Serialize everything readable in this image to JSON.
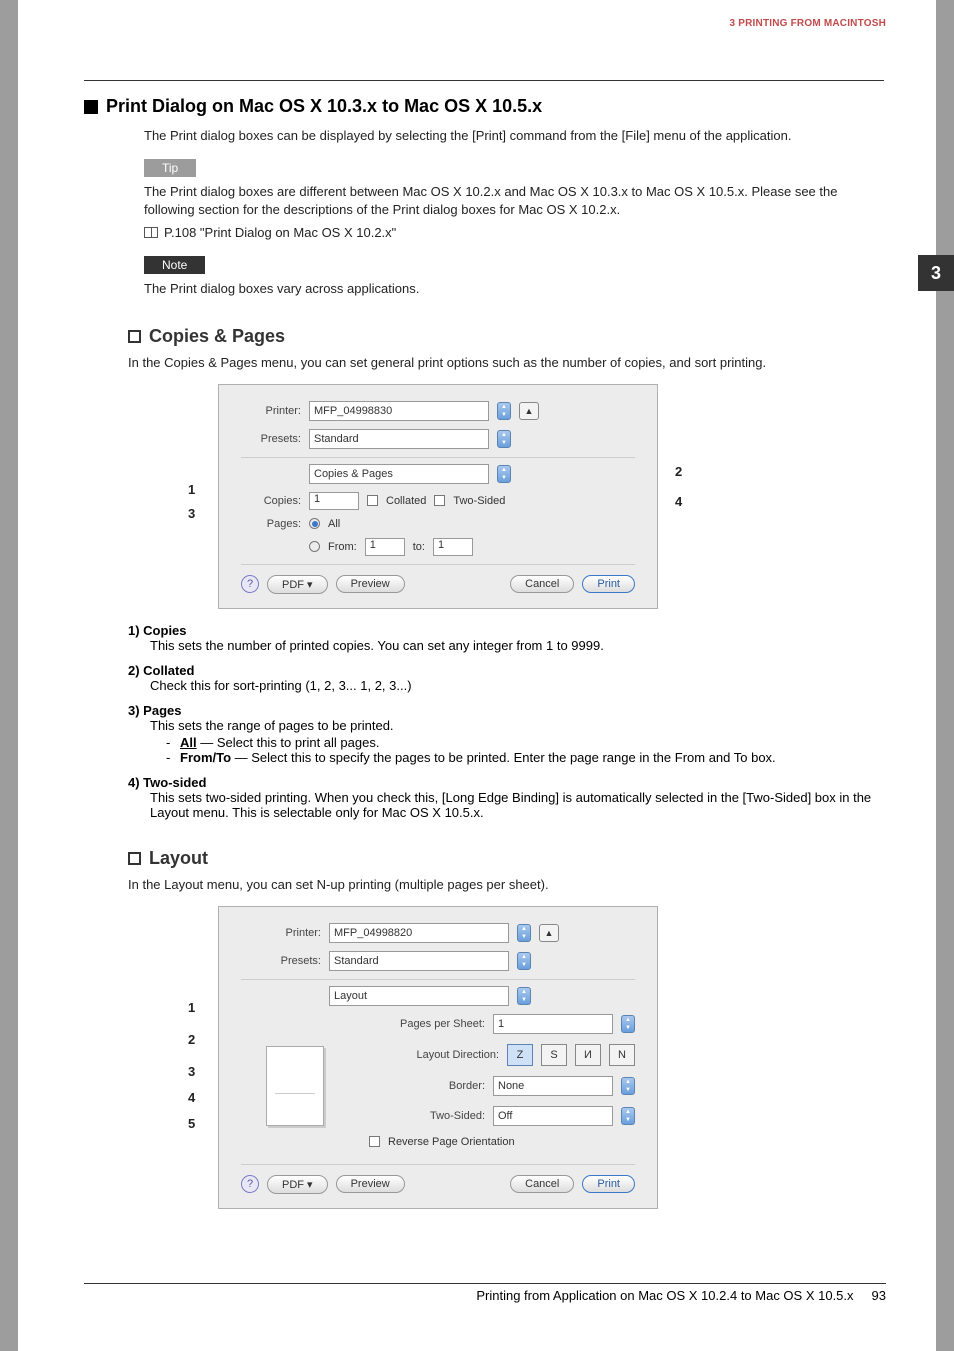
{
  "header": {
    "section": "3 PRINTING FROM MACINTOSH",
    "tab_number": "3"
  },
  "h1": {
    "title": "Print Dialog on Mac OS X 10.3.x to Mac OS X 10.5.x"
  },
  "intro": "The Print dialog boxes can be displayed by selecting the [Print] command from the [File] menu of the application.",
  "tip": {
    "label": "Tip",
    "text": "The Print dialog boxes are different between Mac OS X 10.2.x and Mac OS X 10.3.x to Mac OS X 10.5.x.  Please see the following section for the descriptions of the Print dialog boxes for Mac OS X 10.2.x.",
    "ref": "P.108 \"Print Dialog on Mac OS X 10.2.x\""
  },
  "note": {
    "label": "Note",
    "text": "The Print dialog boxes vary across applications."
  },
  "copies_pages": {
    "heading": "Copies & Pages",
    "intro": "In the Copies & Pages menu, you can set general print options such as the number of copies, and sort printing.",
    "dlg": {
      "printer_lbl": "Printer:",
      "printer_val": "MFP_04998830",
      "presets_lbl": "Presets:",
      "presets_val": "Standard",
      "pane_val": "Copies & Pages",
      "copies_lbl": "Copies:",
      "copies_val": "1",
      "collated_lbl": "Collated",
      "twosided_lbl": "Two-Sided",
      "pages_lbl": "Pages:",
      "all_lbl": "All",
      "from_lbl": "From:",
      "from_val": "1",
      "to_lbl": "to:",
      "to_val": "1",
      "pdf": "PDF ▾",
      "preview": "Preview",
      "cancel": "Cancel",
      "print": "Print",
      "help": "?",
      "c1": "1",
      "c2": "2",
      "c3": "3",
      "c4": "4"
    },
    "list": {
      "i1_t": "1)  Copies",
      "i1_d": "This sets the number of printed copies. You can set any integer from 1 to 9999.",
      "i2_t": "2)  Collated",
      "i2_d": "Check this for sort-printing (1, 2, 3... 1, 2, 3...)",
      "i3_t": "3)  Pages",
      "i3_d": "This sets the range of pages to be printed.",
      "i3_all_b": "All",
      "i3_all_r": " — Select this to print all pages.",
      "i3_ft_b": "From/To",
      "i3_ft_r": " — Select this to specify the pages to be printed. Enter the page range in the From and To box.",
      "i4_t": "4)  Two-sided",
      "i4_d": "This sets two-sided printing. When you check this, [Long Edge Binding] is automatically selected in the [Two-Sided] box in the Layout menu.  This is selectable only for Mac OS X 10.5.x."
    }
  },
  "layout": {
    "heading": "Layout",
    "intro": "In the Layout menu, you can set N-up printing (multiple pages per sheet).",
    "dlg": {
      "printer_lbl": "Printer:",
      "printer_val": "MFP_04998820",
      "presets_lbl": "Presets:",
      "presets_val": "Standard",
      "pane_val": "Layout",
      "pps_lbl": "Pages per Sheet:",
      "pps_val": "1",
      "dir_lbl": "Layout Direction:",
      "border_lbl": "Border:",
      "border_val": "None",
      "twosided_lbl": "Two-Sided:",
      "twosided_val": "Off",
      "reverse_lbl": "Reverse Page Orientation",
      "pdf": "PDF ▾",
      "preview": "Preview",
      "cancel": "Cancel",
      "print": "Print",
      "help": "?",
      "c1": "1",
      "c2": "2",
      "c3": "3",
      "c4": "4",
      "c5": "5"
    }
  },
  "footer": {
    "text": "Printing from Application on Mac OS X 10.2.4 to Mac OS X 10.5.x",
    "page": "93"
  }
}
